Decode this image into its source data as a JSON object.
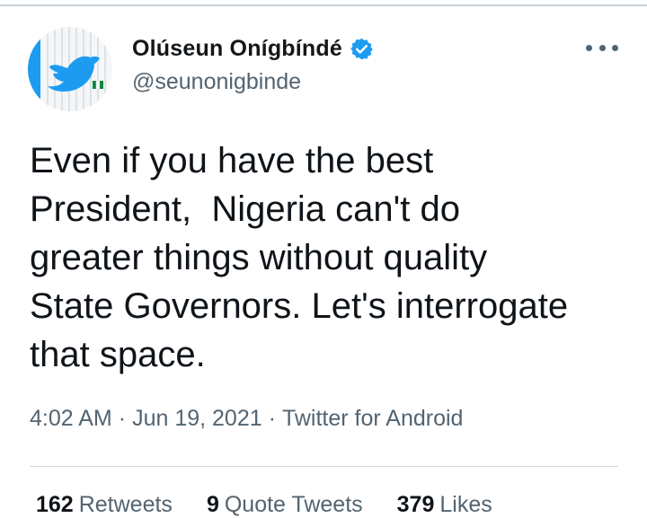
{
  "author": {
    "display_name": "Olúseun Onígbíndé",
    "handle": "@seunonigbinde",
    "verified": true,
    "avatar": "twitter-bird-flag-avatar"
  },
  "tweet": {
    "text": "Even if you have the best\nPresident,  Nigeria can't do\ngreater things without quality\nState Governors. Let's interrogate\nthat space."
  },
  "meta": {
    "time": "4:02 AM",
    "separator": "·",
    "date": "Jun 19, 2021",
    "source": "Twitter for Android"
  },
  "stats": [
    {
      "count": "162",
      "label": "Retweets"
    },
    {
      "count": "9",
      "label": "Quote Tweets"
    },
    {
      "count": "379",
      "label": "Likes"
    }
  ],
  "icons": {
    "verified": "verified-badge-icon",
    "more": "more-options-icon"
  },
  "colors": {
    "accent": "#1d9bf0",
    "secondary_text": "#536471",
    "primary_text": "#0f1419"
  }
}
